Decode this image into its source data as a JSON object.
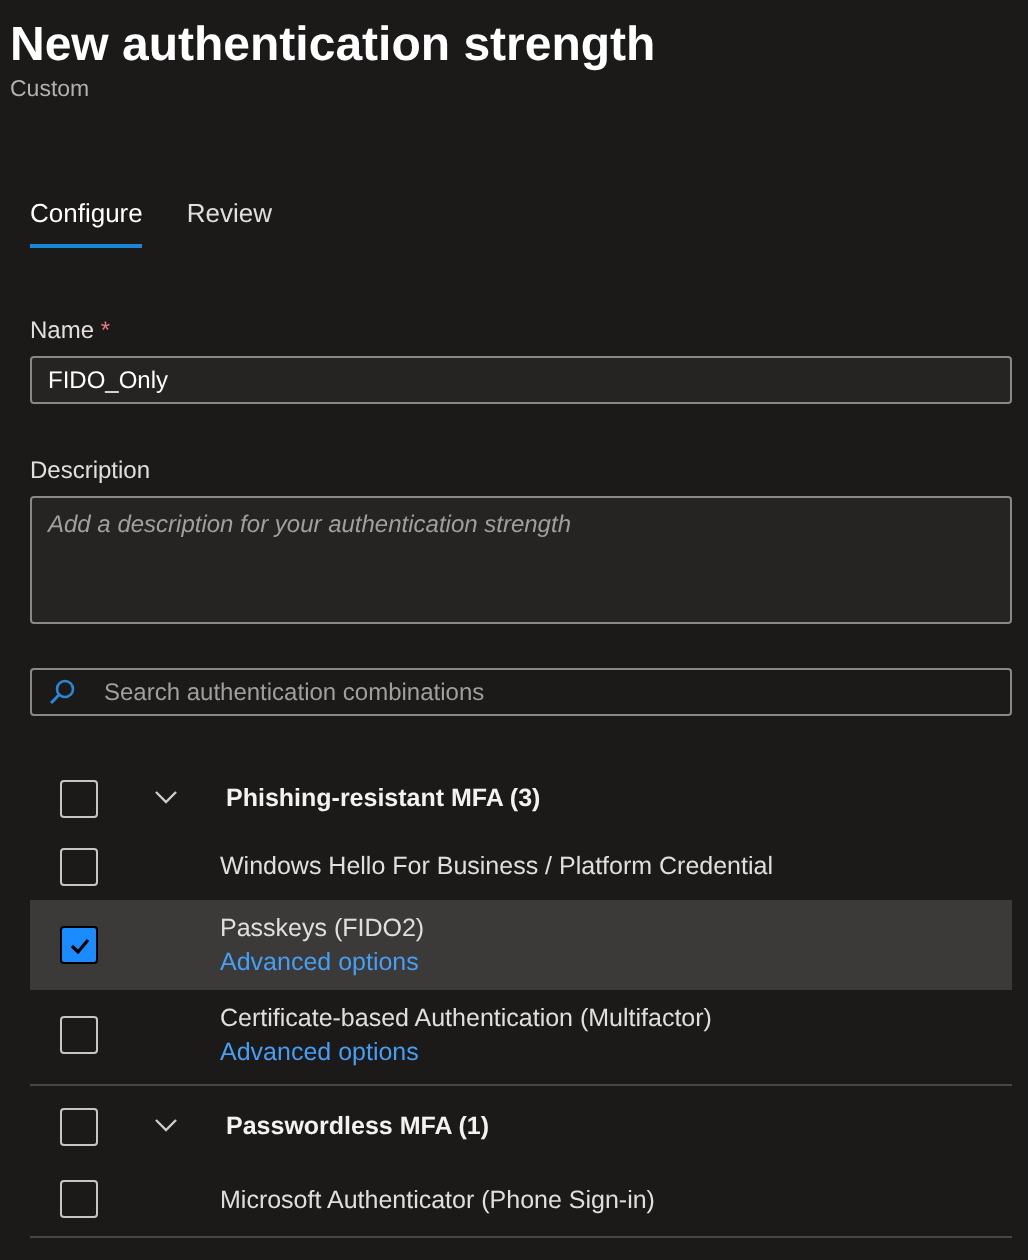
{
  "title": "New authentication strength",
  "subtitle": "Custom",
  "tabs": [
    {
      "label": "Configure",
      "selected": true
    },
    {
      "label": "Review",
      "selected": false
    }
  ],
  "name_field": {
    "label": "Name",
    "required_mark": "*",
    "value": "FIDO_Only"
  },
  "description_field": {
    "label": "Description",
    "placeholder": "Add a description for your authentication strength"
  },
  "search": {
    "placeholder": "Search authentication combinations"
  },
  "groups": [
    {
      "label": "Phishing-resistant MFA (3)",
      "checked": false,
      "expanded": true,
      "children": [
        {
          "label": "Windows Hello For Business / Platform Credential",
          "checked": false,
          "selected": false
        },
        {
          "label": "Passkeys (FIDO2)",
          "checked": true,
          "selected": true,
          "link": "Advanced options"
        },
        {
          "label": "Certificate-based Authentication (Multifactor)",
          "checked": false,
          "selected": false,
          "link": "Advanced options"
        }
      ]
    },
    {
      "label": "Passwordless MFA (1)",
      "checked": false,
      "expanded": true,
      "children": [
        {
          "label": "Microsoft Authenticator (Phone Sign-in)",
          "checked": false,
          "selected": false
        }
      ]
    }
  ]
}
